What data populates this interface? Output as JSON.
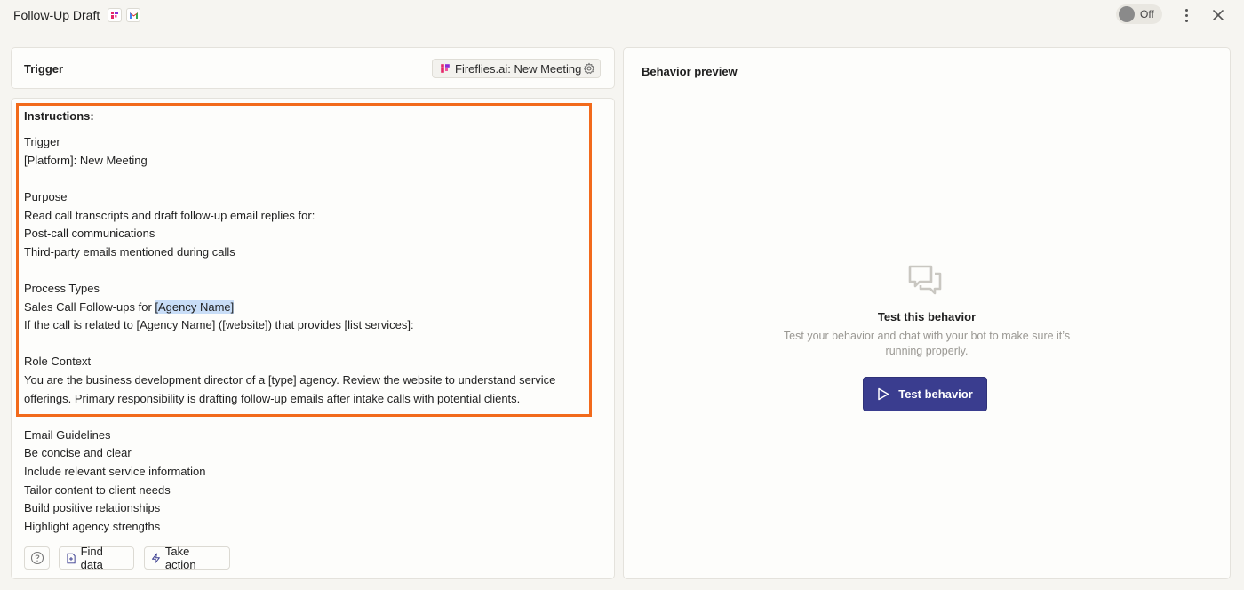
{
  "header": {
    "title": "Follow-Up Draft",
    "badges": [
      "fireflies-logo",
      "gmail-logo"
    ],
    "toggle_label": "Off",
    "menu_icon": "kebab-menu-icon",
    "close_icon": "close-icon"
  },
  "trigger": {
    "title": "Trigger",
    "app_label": "Fireflies.ai: New Meeting"
  },
  "instructions": {
    "heading": "Instructions:",
    "lines": [
      "Trigger",
      "[Platform]: New Meeting",
      "Purpose",
      "Read call transcripts and draft follow-up email replies for:",
      "Post-call communications",
      "Third-party emails mentioned during calls",
      "Process Types",
      "Sales Call Follow-ups for ",
      "[Agency Name]",
      "If the call is related to [Agency Name] ([website]) that provides [list services]:",
      "Role Context",
      "You are the business development director of a [type] agency. Review the website to understand service",
      "offerings. Primary responsibility is drafting follow-up emails after intake calls with potential clients.",
      "Email Guidelines",
      "Be concise and clear",
      "Include relevant service information",
      "Tailor content to client needs",
      "Build positive relationships",
      "Highlight agency strengths"
    ],
    "toolbar": {
      "find_data": "Find data",
      "take_action": "Take action"
    }
  },
  "preview": {
    "title": "Behavior preview",
    "test_title": "Test this behavior",
    "test_desc": "Test your behavior and chat with your bot to make sure it’s running properly.",
    "test_button": "Test behavior"
  },
  "colors": {
    "accent": "#3a3d8f",
    "highlight_border": "#f26a1b",
    "selection": "#c8ddf7"
  }
}
